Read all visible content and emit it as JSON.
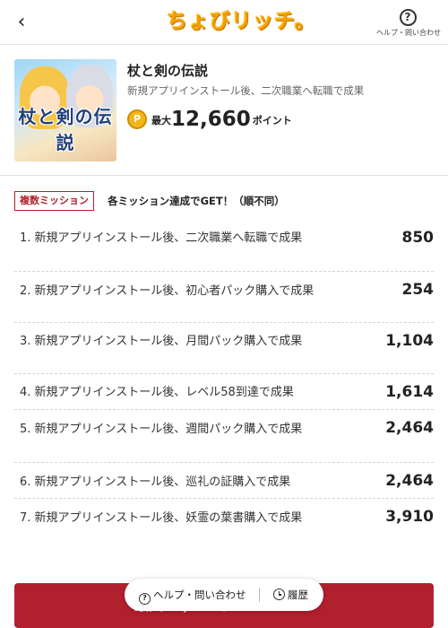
{
  "header": {
    "back_icon": "chevron-left-icon",
    "logo_text": "ちょびリッチ。",
    "help_label": "ヘルプ・問い合わせ",
    "help_icon": "question-circle-icon"
  },
  "app": {
    "thumbnail_title": "杖と剣の伝説",
    "title": "杖と剣の伝説",
    "subtitle": "新規アプリインストール後、二次職業へ転職で成果",
    "coin_icon": "coin-icon",
    "points_prefix": "最大",
    "points_value": "12,660",
    "points_unit": "ポイント"
  },
  "missions": {
    "badge": "複数ミッション",
    "note": "各ミッション達成でGET！（順不同）",
    "items": [
      {
        "text": "1. 新規アプリインストール後、二次職業へ転職で成果",
        "points": "850"
      },
      {
        "text": "2. 新規アプリインストール後、初心者パック購入で成果",
        "points": "254"
      },
      {
        "text": "3. 新規アプリインストール後、月間パック購入で成果",
        "points": "1,104"
      },
      {
        "text": "4. 新規アプリインストール後、レベル58到達で成果",
        "points": "1,614"
      },
      {
        "text": "5. 新規アプリインストール後、週間パック購入で成果",
        "points": "2,464"
      },
      {
        "text": "6. 新規アプリインストール後、巡礼の証購入で成果",
        "points": "2,464"
      },
      {
        "text": "7. 新規アプリインストール後、妖霊の葉書購入で成果",
        "points": "3,910"
      }
    ]
  },
  "cta": {
    "label": "最大12,660ポイントGET!"
  },
  "floating_bar": {
    "help_label": "ヘルプ・問い合わせ",
    "history_label": "履歴",
    "help_icon": "question-circle-icon",
    "history_icon": "history-icon"
  },
  "colors": {
    "accent": "#b3202d",
    "logo": "#f4a100"
  }
}
